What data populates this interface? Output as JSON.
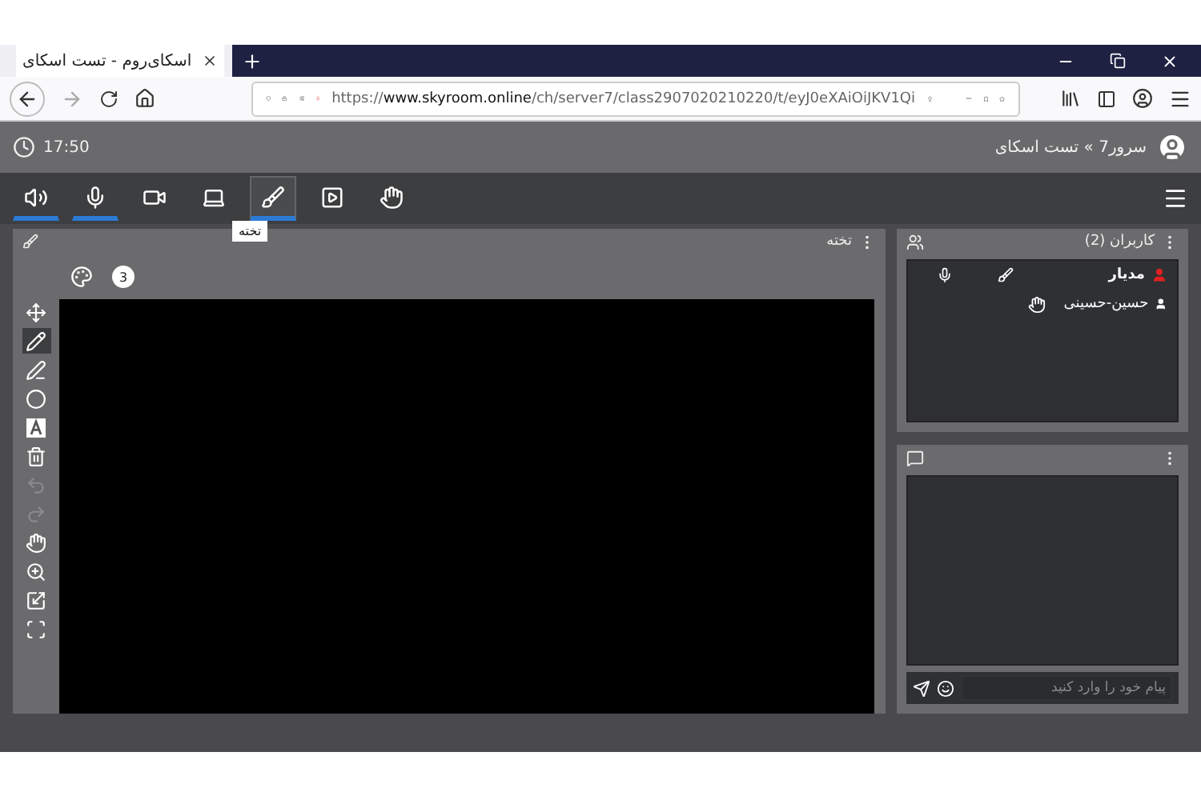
{
  "browser": {
    "tab_title": "اسکای‌روم - تست اسکای",
    "url": "https://**www.skyroom.online**/ch/server7/class2907020210220/t/eyJ0eXAiOiJKV1Qi"
  },
  "header": {
    "time": "17:50",
    "title": "سرور7 » تست اسکای"
  },
  "toolbar": [
    {
      "kind": "speaker",
      "on": true,
      "selected": false
    },
    {
      "kind": "mic",
      "on": true,
      "selected": false
    },
    {
      "kind": "camera",
      "on": false,
      "selected": false
    },
    {
      "kind": "screen",
      "on": false,
      "selected": false
    },
    {
      "kind": "brush",
      "on": true,
      "selected": true
    },
    {
      "kind": "media",
      "on": false,
      "selected": false
    },
    {
      "kind": "hand",
      "on": false,
      "selected": false
    }
  ],
  "tooltip": "تخته",
  "whiteboard": {
    "title": "تخته",
    "page_badge": "3",
    "tools": [
      {
        "kind": "move",
        "selected": false,
        "disabled": false
      },
      {
        "kind": "pencil",
        "selected": true,
        "disabled": false
      },
      {
        "kind": "marker",
        "selected": false,
        "disabled": false
      },
      {
        "kind": "circle",
        "selected": false,
        "disabled": false
      },
      {
        "kind": "text",
        "selected": false,
        "disabled": false
      },
      {
        "kind": "trash",
        "selected": false,
        "disabled": false
      },
      {
        "kind": "undo",
        "selected": false,
        "disabled": true
      },
      {
        "kind": "redo",
        "selected": false,
        "disabled": true
      },
      {
        "kind": "hand",
        "selected": false,
        "disabled": false
      },
      {
        "kind": "zoom",
        "selected": false,
        "disabled": false
      },
      {
        "kind": "fit",
        "selected": false,
        "disabled": false
      },
      {
        "kind": "fullscreen",
        "selected": false,
        "disabled": false
      }
    ]
  },
  "users": {
    "title": "کاربران (2)",
    "list": [
      {
        "name": "مدیار",
        "kind": "admin",
        "mic": true,
        "brush": true,
        "hand": false
      },
      {
        "name": "حسین-حسینی",
        "kind": "user",
        "mic": false,
        "brush": false,
        "hand": true
      }
    ]
  },
  "chat": {
    "placeholder": "پیام خود را وارد کنید"
  }
}
